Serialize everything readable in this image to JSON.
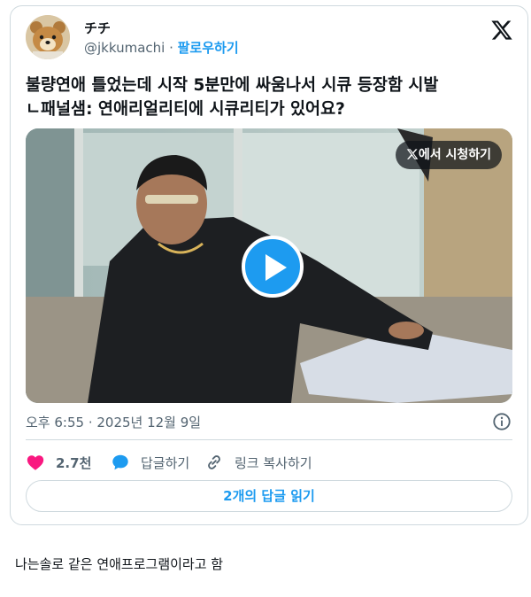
{
  "tweet": {
    "author": {
      "display_name": "チチ",
      "handle": "@jkkumachi",
      "separator": " · ",
      "follow_label": "팔로우하기",
      "avatar_icon": "teddy-bear-avatar"
    },
    "brand_icon": "x-logo-icon",
    "text_lines": [
      "불량연애 틀었는데 시작 5분만에 싸움나서 시큐 등장함 시발",
      "ㄴ패널샘: 연애리얼리티에 시큐리티가 있어요?"
    ],
    "video": {
      "watch_label": "에서 시청하기",
      "play_icon": "play-icon"
    },
    "timestamp": "오후 6:55 · 2025년 12월 9일",
    "info_icon": "info-icon",
    "actions": {
      "like_count": "2.7천",
      "like_icon": "heart-icon",
      "reply_label": "답글하기",
      "reply_icon": "speech-bubble-icon",
      "copy_label": "링크 복사하기",
      "copy_icon": "link-icon"
    },
    "read_replies_label": "2개의 답글 읽기"
  },
  "caption": "나는솔로 같은 연애프로그램이라고 함",
  "colors": {
    "accent": "#1d9bf0",
    "like": "#f91880",
    "text": "#0f1419",
    "muted": "#536471",
    "border": "#cfd9de"
  }
}
